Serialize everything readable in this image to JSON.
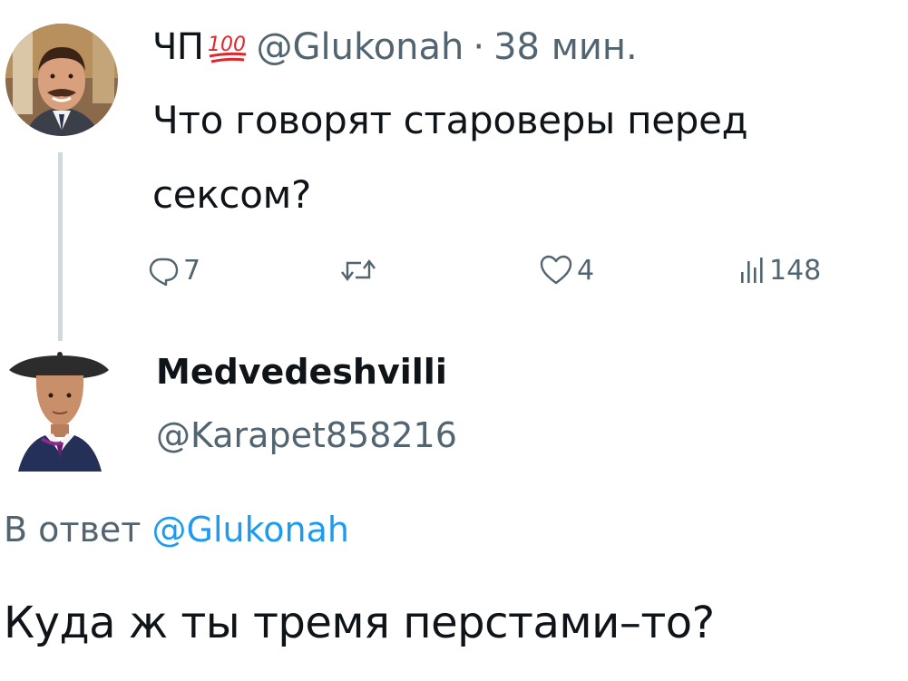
{
  "tweet": {
    "author_name": "ЧП",
    "badge_icon": "hundred-points-emoji",
    "handle": "@Glukonah",
    "separator": "·",
    "time": "38 мин.",
    "text": "Что говорят староверы перед сексом?",
    "actions": {
      "reply_count": "7",
      "retweet_count": "",
      "like_count": "4",
      "views_count": "148"
    }
  },
  "reply": {
    "author_name": "Medvedeshvilli",
    "handle": "@Karapet858216",
    "reply_to_prefix": "В ответ",
    "reply_to_handle": "@Glukonah",
    "text": "Куда ж ты тремя перстами–то?"
  },
  "colors": {
    "text": "#0f1419",
    "secondary": "#536471",
    "link": "#1d9bf0",
    "thread_line": "#cfd9de",
    "emoji_red": "#e0262b"
  }
}
